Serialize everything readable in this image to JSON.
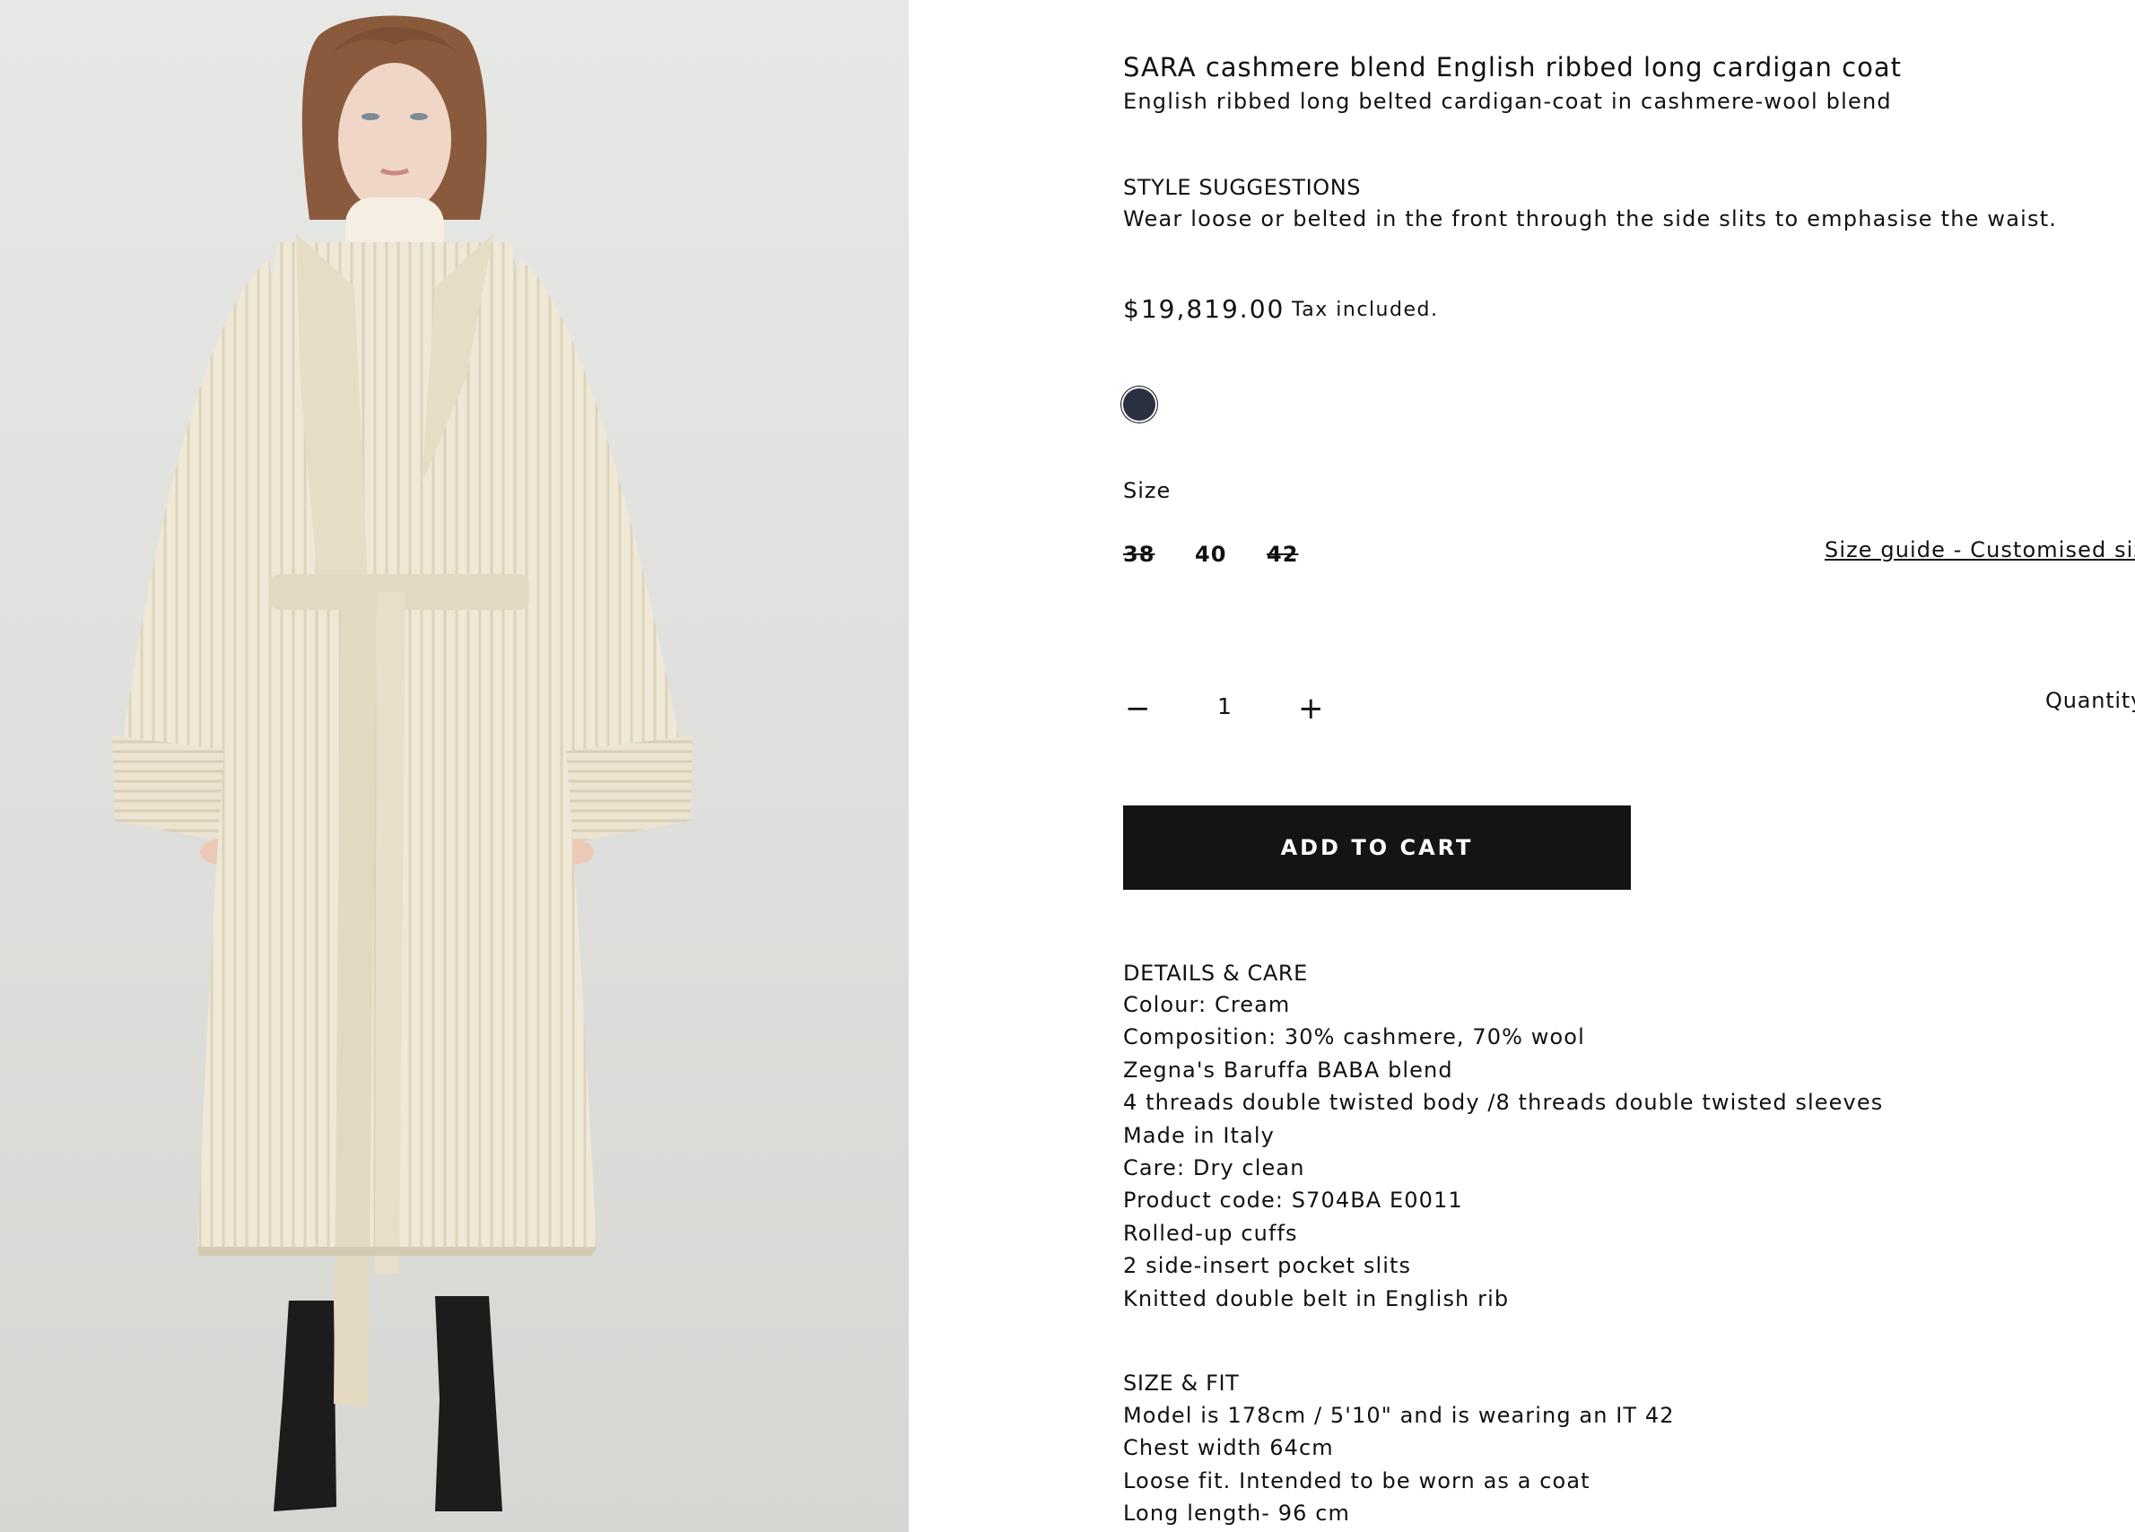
{
  "product": {
    "title": "SARA cashmere blend English ribbed long cardigan coat",
    "subtitle": "English ribbed long belted cardigan-coat in cashmere-wool blend",
    "image_alt": "Model wearing cream English ribbed long belted cardigan coat"
  },
  "style": {
    "heading": "STYLE SUGGESTIONS",
    "text": "Wear loose or belted in the front through the side slits to emphasise the waist."
  },
  "pricing": {
    "price": "$19,819.00",
    "tax_note": "Tax included."
  },
  "colors": {
    "swatch": "#2b3040",
    "accent": "#141414"
  },
  "size": {
    "label": "Size",
    "options": [
      {
        "value": "38",
        "available": false
      },
      {
        "value": "40",
        "available": true
      },
      {
        "value": "42",
        "available": false
      }
    ],
    "guide_link": "Size guide - Customised size*"
  },
  "quantity": {
    "minus": "−",
    "value": "1",
    "plus": "+",
    "label": "Quantity"
  },
  "cart": {
    "label": "ADD TO CART"
  },
  "details": {
    "heading": "DETAILS & CARE",
    "items": [
      "Colour: Cream",
      "Composition: 30% cashmere, 70% wool",
      "Zegna's Baruffa BABA blend",
      "4 threads double twisted body /8 threads double twisted sleeves",
      "Made in Italy",
      "Care: Dry clean",
      "Product code: S704BA E0011",
      "Rolled-up cuffs",
      "2 side-insert pocket slits",
      "Knitted double belt in English rib"
    ]
  },
  "fit": {
    "heading": "SIZE & FIT",
    "items": [
      "Model is 178cm / 5'10\" and is wearing an IT 42",
      "Chest width 64cm",
      "Loose fit. Intended to be worn as a coat",
      "Long length- 96 cm"
    ]
  }
}
